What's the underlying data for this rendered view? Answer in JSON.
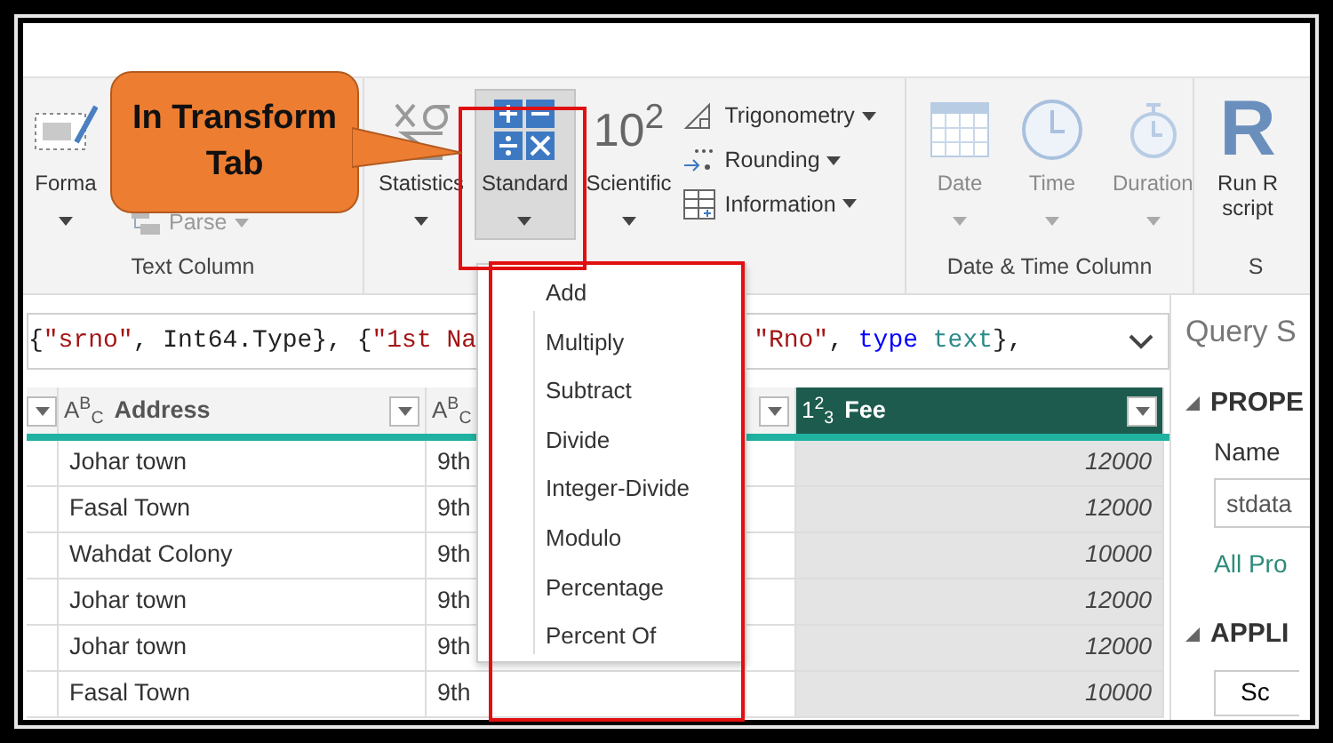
{
  "callout": {
    "text": "In Transform Tab"
  },
  "ribbon": {
    "groups": [
      {
        "label": "Text Column",
        "buttons": [
          {
            "kind": "large",
            "label": "Forma",
            "caret": true,
            "disabled": false,
            "expanded": false
          },
          {
            "kind": "small",
            "label": "Parse",
            "caret": true,
            "disabled": true,
            "expanded": false
          }
        ]
      },
      {
        "buttons": [
          {
            "kind": "large",
            "label": "Statistics",
            "caret": true,
            "disabled": false,
            "expanded": false
          },
          {
            "kind": "large",
            "label": "Standard",
            "caret": true,
            "disabled": false,
            "expanded": true
          },
          {
            "kind": "large",
            "glyph": "10$^{2}$",
            "label": "Scientific",
            "caret": true,
            "disabled": false,
            "expanded": false
          },
          {
            "kind": "small",
            "label": "Trigonometry",
            "caret": true,
            "disabled": false,
            "expanded": false
          },
          {
            "kind": "small",
            "label": "Rounding",
            "caret": true,
            "disabled": false,
            "expanded": false
          },
          {
            "kind": "small",
            "label": "Information",
            "caret": true,
            "disabled": false,
            "expanded": false
          }
        ]
      },
      {
        "label": "Date & Time Column",
        "buttons": [
          {
            "kind": "large",
            "label": "Date",
            "caret": true,
            "disabled": true,
            "expanded": false
          },
          {
            "kind": "large",
            "label": "Time",
            "caret": true,
            "disabled": true,
            "expanded": false
          },
          {
            "kind": "large",
            "label": "Duration",
            "caret": true,
            "disabled": true,
            "expanded": false
          }
        ]
      },
      {
        "label": "S",
        "buttons": [
          {
            "kind": "large",
            "glyph": "R",
            "label": "Run R script",
            "caret": false,
            "disabled": false,
            "expanded": false
          }
        ]
      }
    ]
  },
  "formula": {
    "fragments": [
      [
        {
          "text": "{",
          "kind": "plain"
        },
        {
          "text": "\"srno\"",
          "kind": "string"
        },
        {
          "text": ", Int64.Type}, {",
          "kind": "plain"
        },
        {
          "text": "\"1st Na",
          "kind": "string"
        }
      ],
      [
        {
          "text": "\"Rno\"",
          "kind": "string"
        },
        {
          "text": ", ",
          "kind": "plain"
        },
        {
          "text": "type",
          "kind": "keyword"
        },
        {
          "text": " text",
          "kind": "type"
        },
        {
          "text": "},",
          "kind": "plain"
        }
      ]
    ]
  },
  "table": {
    "columns": [
      {
        "filter_button": true,
        "selected": false
      },
      {
        "type_glyph": "A$^{B}$$_{C}$",
        "label": "Address",
        "filter_button": true,
        "selected": false
      },
      {
        "type_glyph": "A$^{B}$$_{C}$",
        "filter_button": false,
        "selected": false
      },
      {
        "filter_button": true,
        "selected": false
      },
      {
        "type_glyph": "1$^{2}$$_{3}$",
        "label": "Fee",
        "filter_button": true,
        "selected": true
      }
    ],
    "rows": [
      {
        "address": "Johar town",
        "column_3": "9th",
        "fee": "12000"
      },
      {
        "address": "Fasal Town",
        "column_3": "9th",
        "fee": "12000"
      },
      {
        "address": "Wahdat Colony",
        "column_3": "9th",
        "fee": "10000"
      },
      {
        "address": "Johar town",
        "column_3": "9th",
        "fee": "12000"
      },
      {
        "address": "Johar town",
        "column_3": "9th",
        "fee": "12000"
      },
      {
        "address": "Fasal Town",
        "column_3": "9th",
        "fee": "10000"
      }
    ]
  },
  "menu": {
    "items": [
      {
        "label": "Add"
      },
      {
        "label": "Multiply"
      },
      {
        "label": "Subtract"
      },
      {
        "label": "Divide"
      },
      {
        "label": "Integer-Divide"
      },
      {
        "label": "Modulo"
      },
      {
        "label": "Percentage"
      },
      {
        "label": "Percent Of"
      }
    ]
  },
  "query_settings": {
    "title": "Query S",
    "properties": {
      "heading": "PROPE",
      "expanded": true,
      "name_label": "Name",
      "name_value": "stdata",
      "link": "All Pro"
    },
    "applied_steps": {
      "heading": "APPLI",
      "expanded": true,
      "button": "Sc"
    }
  }
}
